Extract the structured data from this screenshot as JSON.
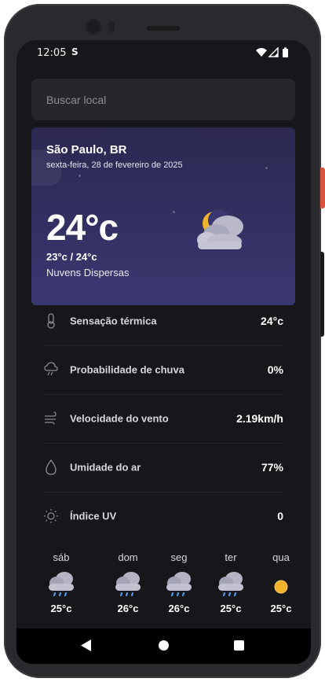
{
  "status": {
    "time": "12:05",
    "app_badge": "S"
  },
  "search": {
    "placeholder": "Buscar local",
    "value": ""
  },
  "current": {
    "city": "São Paulo, BR",
    "date": "sexta-feira, 28 de fevereiro de 2025",
    "temperature": "24°c",
    "range": "23°c / 24°c",
    "description": "Nuvens Dispersas",
    "icon": "moon-cloud-icon"
  },
  "details": [
    {
      "icon": "thermometer-icon",
      "label": "Sensação térmica",
      "value": "24°c"
    },
    {
      "icon": "rain-cloud-icon",
      "label": "Probabilidade de chuva",
      "value": "0%"
    },
    {
      "icon": "wind-icon",
      "label": "Velocidade do vento",
      "value": "2.19km/h"
    },
    {
      "icon": "droplet-icon",
      "label": "Umidade do ar",
      "value": "77%"
    },
    {
      "icon": "sun-icon",
      "label": "Índice UV",
      "value": "0"
    }
  ],
  "forecast": [
    {
      "day": "sáb",
      "icon": "rain-cloud-icon",
      "temp": "25°c"
    },
    {
      "day": "dom",
      "icon": "rain-cloud-icon",
      "temp": "26°c"
    },
    {
      "day": "seg",
      "icon": "rain-cloud-icon",
      "temp": "26°c"
    },
    {
      "day": "ter",
      "icon": "rain-cloud-icon",
      "temp": "25°c"
    },
    {
      "day": "qua",
      "icon": "sun-icon",
      "temp": "25°c"
    }
  ],
  "colors": {
    "background": "#17171b",
    "card_top": "#2b2850",
    "card_bottom": "#3a3870",
    "sun": "#f2b32c"
  }
}
